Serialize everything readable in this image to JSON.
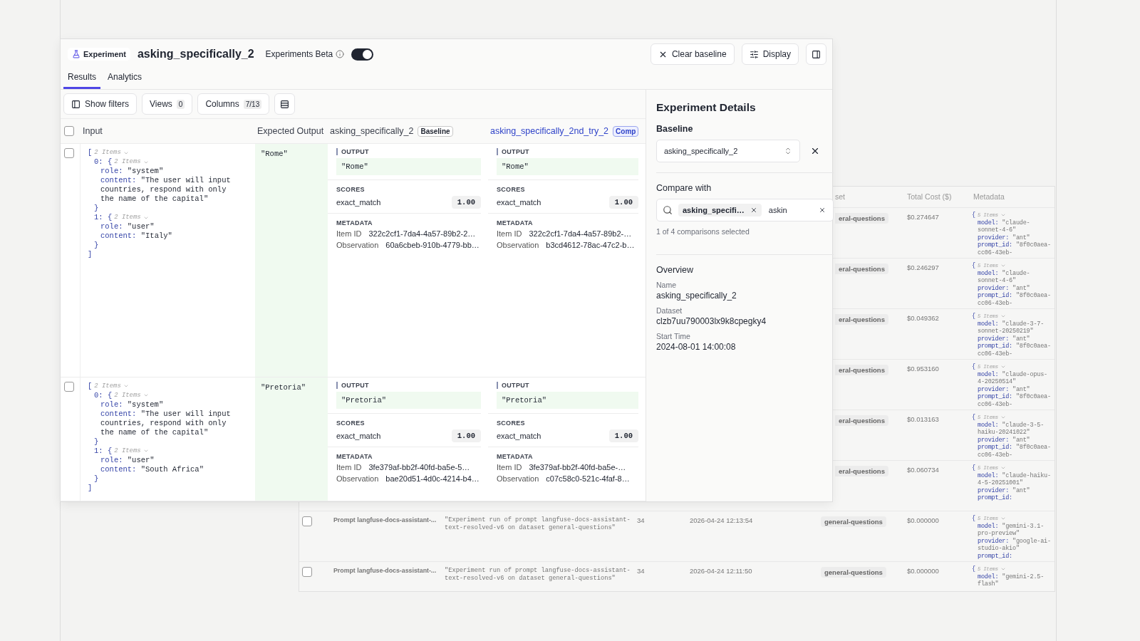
{
  "experiment": {
    "badge": "Experiment",
    "title": "asking_specifically_2",
    "beta_label": "Experiments Beta",
    "beta_toggle": {
      "on": true
    },
    "buttons": [
      {
        "kind": "clear",
        "label": "Clear baseline"
      },
      {
        "kind": "display",
        "label": "Display"
      },
      {
        "kind": "panel"
      }
    ],
    "tabs": [
      {
        "label": "Results",
        "selected": true
      },
      {
        "label": "Analytics",
        "selected": false
      }
    ],
    "toolbar": {
      "show_filters": "Show filters",
      "views": {
        "label": "Views",
        "count": "0"
      },
      "columns": {
        "label": "Columns",
        "count": "7/13"
      }
    },
    "table": {
      "select_all_checked": false,
      "columns": [
        {
          "kind": "input",
          "label": "Input"
        },
        {
          "kind": "expected",
          "label": "Expected Output"
        },
        {
          "kind": "run",
          "label": "asking_specifically_2",
          "badge": "Baseline",
          "link": false
        },
        {
          "kind": "run",
          "label": "asking_specifically_2nd_try_2",
          "badge": "Comp",
          "link": true
        }
      ],
      "rows": [
        {
          "checked": false,
          "input": {
            "open": "[",
            "count": "2 Items",
            "close": "]",
            "children": [
              {
                "key": "0:",
                "open": "{",
                "count": "2 Items",
                "close": "}",
                "children": [
                  {
                    "key": "role:",
                    "value": "\"system\""
                  },
                  {
                    "key": "content:",
                    "value": "\"The user will input countries, respond with only the name of the capital\""
                  }
                ]
              },
              {
                "key": "1:",
                "open": "{",
                "count": "2 Items",
                "close": "}",
                "children": [
                  {
                    "key": "role:",
                    "value": "\"user\""
                  },
                  {
                    "key": "content:",
                    "value": "\"Italy\""
                  }
                ]
              }
            ]
          },
          "expected": "\"Rome\"",
          "runs": [
            {
              "output_label": "OUTPUT",
              "output": "\"Rome\"",
              "scores_label": "SCORES",
              "score_name": "exact_match",
              "score": "1.00",
              "metadata_label": "METADATA",
              "item_id_label": "Item ID",
              "item_id": "322c2cf1-7da4-4a57-89b2-2…",
              "observation_label": "Observation",
              "observation": "60a6cbeb-910b-4779-bb…"
            },
            {
              "output_label": "OUTPUT",
              "output": "\"Rome\"",
              "scores_label": "SCORES",
              "score_name": "exact_match",
              "score": "1.00",
              "metadata_label": "METADATA",
              "item_id_label": "Item ID",
              "item_id": "322c2cf1-7da4-4a57-89b2-…",
              "observation_label": "Observation",
              "observation": "b3cd4612-78ac-47c2-b…"
            }
          ]
        },
        {
          "checked": false,
          "input": {
            "open": "[",
            "count": "2 Items",
            "close": "]",
            "children": [
              {
                "key": "0:",
                "open": "{",
                "count": "2 Items",
                "close": "}",
                "children": [
                  {
                    "key": "role:",
                    "value": "\"system\""
                  },
                  {
                    "key": "content:",
                    "value": "\"The user will input countries, respond with only the name of the capital\""
                  }
                ]
              },
              {
                "key": "1:",
                "open": "{",
                "count": "2 Items",
                "close": "}",
                "children": [
                  {
                    "key": "role:",
                    "value": "\"user\""
                  },
                  {
                    "key": "content:",
                    "value": "\"South Africa\""
                  }
                ]
              }
            ]
          },
          "expected": "\"Pretoria\"",
          "runs": [
            {
              "output_label": "OUTPUT",
              "output": "\"Pretoria\"",
              "scores_label": "SCORES",
              "score_name": "exact_match",
              "score": "1.00",
              "metadata_label": "METADATA",
              "item_id_label": "Item ID",
              "item_id": "3fe379af-bb2f-40fd-ba5e-5…",
              "observation_label": "Observation",
              "observation": "bae20d51-4d0c-4214-b4…"
            },
            {
              "output_label": "OUTPUT",
              "output": "\"Pretoria\"",
              "scores_label": "SCORES",
              "score_name": "exact_match",
              "score": "1.00",
              "metadata_label": "METADATA",
              "item_id_label": "Item ID",
              "item_id": "3fe379af-bb2f-40fd-ba5e-…",
              "observation_label": "Observation",
              "observation": "c07c58c0-521c-4faf-8…"
            }
          ]
        }
      ]
    },
    "details": {
      "title": "Experiment Details",
      "baseline": {
        "label": "Baseline",
        "value": "asking_specifically_2"
      },
      "compare": {
        "label": "Compare with",
        "chips": [
          "asking_specifi…"
        ],
        "value": "askin",
        "summary": "1 of 4 comparisons selected"
      },
      "overview": {
        "title": "Overview",
        "fields": [
          {
            "label": "Name",
            "value": "asking_specifically_2"
          },
          {
            "label": "Dataset",
            "value": "clzb7uu790003lx9k8cpegky4"
          },
          {
            "label": "Start Time",
            "value": "2024-08-01 14:00:08"
          }
        ]
      }
    }
  },
  "background_table": {
    "header": [
      "set",
      "Total Cost ($)",
      "Metadata"
    ],
    "partial_rows": [
      {
        "dataset": "eral-questions",
        "cost": "$0.274647",
        "metadata": {
          "open": "{",
          "count": "5 Items",
          "children": [
            {
              "key": "model:",
              "value": "\"claude-sonnet-4-6\""
            },
            {
              "key": "provider:",
              "value": "\"ant\""
            },
            {
              "key": "prompt_id:",
              "value": "\"8f0c0aea-cc06-43eb-"
            }
          ]
        }
      },
      {
        "dataset": "eral-questions",
        "cost": "$0.246297",
        "metadata": {
          "open": "{",
          "count": "5 Items",
          "children": [
            {
              "key": "model:",
              "value": "\"claude-sonnet-4-6\""
            },
            {
              "key": "provider:",
              "value": "\"ant\""
            },
            {
              "key": "prompt_id:",
              "value": "\"8f0c0aea-cc06-43eb-"
            }
          ]
        }
      },
      {
        "dataset": "eral-questions",
        "cost": "$0.049362",
        "metadata": {
          "open": "{",
          "count": "5 Items",
          "children": [
            {
              "key": "model:",
              "value": "\"claude-3-7-sonnet-20250219\""
            },
            {
              "key": "provider:",
              "value": "\"ant\""
            },
            {
              "key": "prompt_id:",
              "value": "\"8f0c0aea-cc06-43eb-"
            }
          ]
        }
      },
      {
        "dataset": "eral-questions",
        "cost": "$0.953160",
        "metadata": {
          "open": "{",
          "count": "5 Items",
          "children": [
            {
              "key": "model:",
              "value": "\"claude-opus-4-20250514\""
            },
            {
              "key": "provider:",
              "value": "\"ant\""
            },
            {
              "key": "prompt_id:",
              "value": "\"8f0c0aea-cc06-43eb-"
            }
          ]
        }
      },
      {
        "dataset": "eral-questions",
        "cost": "$0.013163",
        "metadata": {
          "open": "{",
          "count": "5 Items",
          "children": [
            {
              "key": "model:",
              "value": "\"claude-3-5-haiku-20241022\""
            },
            {
              "key": "provider:",
              "value": "\"ant\""
            },
            {
              "key": "prompt_id:",
              "value": "\"8f0c0aea-cc06-43eb-"
            }
          ]
        }
      },
      {
        "dataset": "eral-questions",
        "cost": "$0.060734",
        "metadata": {
          "open": "{",
          "count": "5 Items",
          "children": [
            {
              "key": "model:",
              "value": "\"claude-haiku-4-5-20251001\""
            },
            {
              "key": "provider:",
              "value": "\"ant\""
            },
            {
              "key": "prompt_id:"
            }
          ]
        }
      }
    ],
    "rows": [
      {
        "checked": false,
        "name": "Prompt langfuse-docs-assistant-...",
        "description": "\"Experiment run of prompt langfuse-docs-assistant-text-resolved-v6 on dataset general-questions\"",
        "count": "34",
        "time": "2026-04-24 12:13:54",
        "dataset": "general-questions",
        "cost": "$0.000000",
        "metadata": {
          "open": "{",
          "count": "5 Items",
          "children": [
            {
              "key": "model:",
              "value": "\"gemini-3.1-pro-preview\""
            },
            {
              "key": "provider:",
              "value": "\"google-ai-studio-akio\""
            },
            {
              "key": "prompt_id:"
            }
          ]
        }
      },
      {
        "checked": false,
        "name": "Prompt langfuse-docs-assistant-...",
        "description": "\"Experiment run of prompt langfuse-docs-assistant-text-resolved-v6 on dataset general-questions\"",
        "count": "34",
        "time": "2026-04-24 12:11:50",
        "dataset": "general-questions",
        "cost": "$0.000000",
        "metadata": {
          "open": "{",
          "count": "5 Items",
          "children": [
            {
              "key": "model:",
              "value": "\"gemini-2.5-flash\""
            }
          ]
        }
      }
    ]
  }
}
